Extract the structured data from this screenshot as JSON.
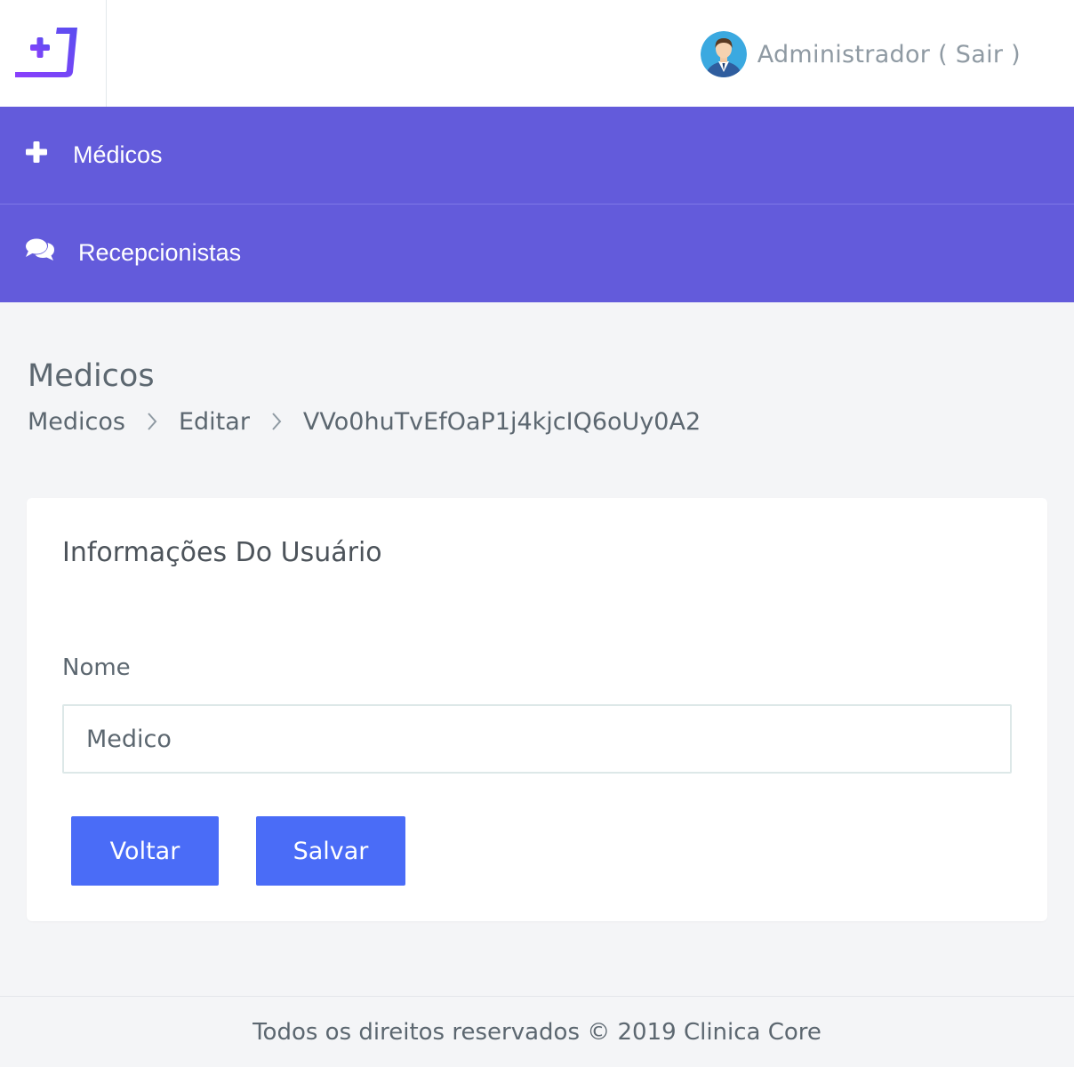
{
  "header": {
    "user_label": "Administrador ( Sair )"
  },
  "menu": {
    "items": [
      {
        "label": "Médicos",
        "icon": "plus-icon"
      },
      {
        "label": "Recepcionistas",
        "icon": "comments-icon"
      }
    ]
  },
  "page": {
    "title": "Medicos",
    "breadcrumb": [
      "Medicos",
      "Editar",
      "VVo0huTvEfOaP1j4kjcIQ6oUy0A2"
    ]
  },
  "card": {
    "title": "Informações Do Usuário",
    "name_label": "Nome",
    "name_value": "Medico",
    "back_button": "Voltar",
    "save_button": "Salvar"
  },
  "footer": {
    "text": "Todos os direitos reservados © 2019 Clinica Core"
  },
  "colors": {
    "menu_bg": "#635bdb",
    "button": "#4a6cf7",
    "page_bg": "#f4f5f7"
  }
}
